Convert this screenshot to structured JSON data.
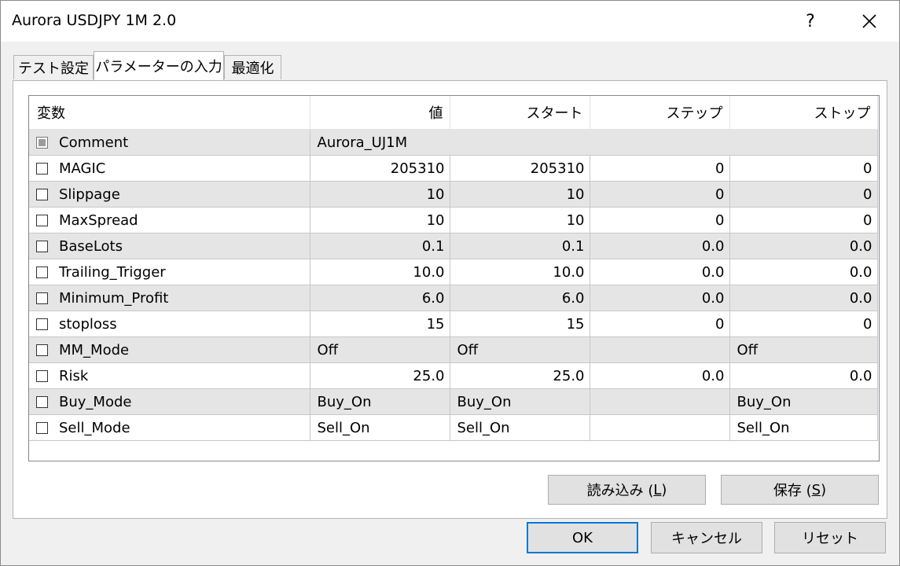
{
  "window": {
    "title": "Aurora USDJPY 1M 2.0",
    "help_label": "?"
  },
  "tabs": [
    {
      "label": "テスト設定"
    },
    {
      "label": "パラメーターの入力"
    },
    {
      "label": "最適化"
    }
  ],
  "columns": [
    "変数",
    "値",
    "スタート",
    "ステップ",
    "ストップ"
  ],
  "rows": [
    {
      "name": "Comment",
      "value": "Aurora_UJ1M",
      "start": "",
      "step": "",
      "stop": ""
    },
    {
      "name": "MAGIC",
      "value": "205310",
      "start": "205310",
      "step": "0",
      "stop": "0"
    },
    {
      "name": "Slippage",
      "value": "10",
      "start": "10",
      "step": "0",
      "stop": "0"
    },
    {
      "name": "MaxSpread",
      "value": "10",
      "start": "10",
      "step": "0",
      "stop": "0"
    },
    {
      "name": "BaseLots",
      "value": "0.1",
      "start": "0.1",
      "step": "0.0",
      "stop": "0.0"
    },
    {
      "name": "Trailing_Trigger",
      "value": "10.0",
      "start": "10.0",
      "step": "0.0",
      "stop": "0.0"
    },
    {
      "name": "Minimum_Profit",
      "value": "6.0",
      "start": "6.0",
      "step": "0.0",
      "stop": "0.0"
    },
    {
      "name": "stoploss",
      "value": "15",
      "start": "15",
      "step": "0",
      "stop": "0"
    },
    {
      "name": "MM_Mode",
      "value": "Off",
      "start": "Off",
      "step": "",
      "stop": "Off"
    },
    {
      "name": "Risk",
      "value": "25.0",
      "start": "25.0",
      "step": "0.0",
      "stop": "0.0"
    },
    {
      "name": "Buy_Mode",
      "value": "Buy_On",
      "start": "Buy_On",
      "step": "",
      "stop": "Buy_On"
    },
    {
      "name": "Sell_Mode",
      "value": "Sell_On",
      "start": "Sell_On",
      "step": "",
      "stop": "Sell_On"
    }
  ],
  "buttons": {
    "load": {
      "label": "読み込み (",
      "key": "L",
      "tail": ")"
    },
    "save": {
      "label": "保存 (",
      "key": "S",
      "tail": ")"
    },
    "ok": "OK",
    "cancel": "キャンセル",
    "reset": "リセット"
  }
}
